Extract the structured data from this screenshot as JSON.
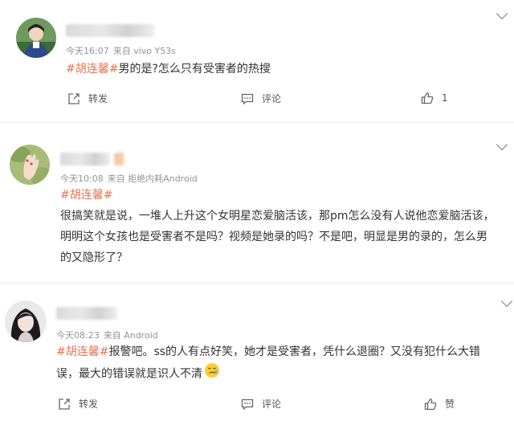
{
  "posts": [
    {
      "meta": {
        "time": "今天16:07",
        "source": "来自 vivo Y53s"
      },
      "tag": "#胡连馨#",
      "text": "男的是?怎么只有受害者的热搜",
      "actions": {
        "repost": "转发",
        "comment": "评论",
        "like_count": "1"
      }
    },
    {
      "meta": {
        "time": "今天10:08",
        "source": "来自 拒绝内耗Android"
      },
      "tag": "#胡连馨#",
      "lines": [
        "很搞笑就是说，一堆人上升这个女明星恋爱脑活该，那pm怎么没有人说他恋爱脑活该，",
        "明明这个女孩也是受害者不是吗？视频是她录的吗？不是吧，明显是男的录的，怎么男",
        "的又隐形了？"
      ]
    },
    {
      "meta": {
        "time": "今天08:23",
        "source": "来自 Android"
      },
      "tag": "#胡连馨#",
      "lines": [
        "报警吧。ss的人有点好笑，她才是受害者，凭什么退圈？又没有犯什么大错",
        "误，最大的错误就是识人不清"
      ],
      "actions": {
        "repost": "转发",
        "comment": "评论",
        "like_label": "赞"
      }
    }
  ]
}
